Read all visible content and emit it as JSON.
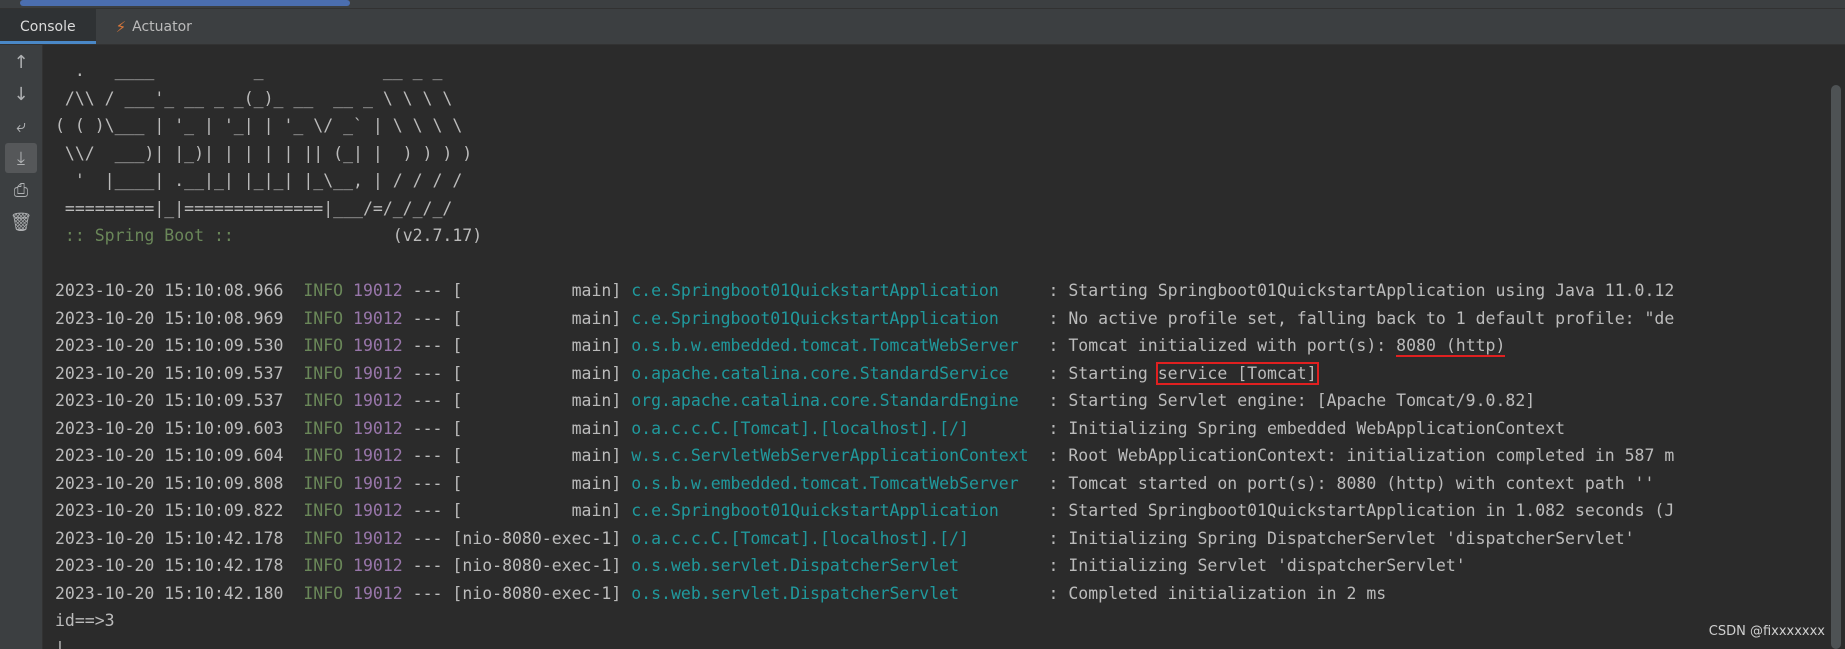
{
  "tabs": [
    {
      "label": "Console",
      "active": true
    },
    {
      "label": "Actuator",
      "icon": "actuator-icon"
    }
  ],
  "toolbar": [
    {
      "name": "scroll-up-icon",
      "glyph": "↑"
    },
    {
      "name": "scroll-down-icon",
      "glyph": "↓"
    },
    {
      "name": "soft-wrap-icon",
      "glyph": "⤶"
    },
    {
      "name": "scroll-to-end-icon",
      "glyph": "⤓",
      "active": true
    },
    {
      "name": "print-icon",
      "glyph": "⎙"
    },
    {
      "name": "clear-all-icon",
      "glyph": "🗑"
    }
  ],
  "banner": [
    "  .   ____          _            __ _ _",
    " /\\\\ / ___'_ __ _ _(_)_ __  __ _ \\ \\ \\ \\",
    "( ( )\\___ | '_ | '_| | '_ \\/ _` | \\ \\ \\ \\",
    " \\\\/  ___)| |_)| | | | | || (_| |  ) ) ) )",
    "  '  |____| .__|_| |_|_| |_\\__, | / / / /",
    " =========|_|==============|___/=/_/_/_/"
  ],
  "spring_label": " :: Spring Boot :: ",
  "spring_version": "               (v2.7.17)",
  "logs": [
    {
      "ts": "2023-10-20 15:10:08.966",
      "level": "INFO",
      "pid": "19012",
      "thread": "           main",
      "logger": "c.e.Springboot01QuickstartApplication    ",
      "msg": "Starting Springboot01QuickstartApplication using Java 11.0.12"
    },
    {
      "ts": "2023-10-20 15:10:08.969",
      "level": "INFO",
      "pid": "19012",
      "thread": "           main",
      "logger": "c.e.Springboot01QuickstartApplication    ",
      "msg": "No active profile set, falling back to 1 default profile: \"de"
    },
    {
      "ts": "2023-10-20 15:10:09.530",
      "level": "INFO",
      "pid": "19012",
      "thread": "           main",
      "logger": "o.s.b.w.embedded.tomcat.TomcatWebServer  ",
      "msg_pre": "Tomcat initialized with port(s): ",
      "msg_hl": "8080 (http)",
      "msg_post": "",
      "hl": "underline"
    },
    {
      "ts": "2023-10-20 15:10:09.537",
      "level": "INFO",
      "pid": "19012",
      "thread": "           main",
      "logger": "o.apache.catalina.core.StandardService   ",
      "msg_pre": "Starting ",
      "msg_hl": "service [Tomcat]",
      "msg_post": "",
      "hl": "box"
    },
    {
      "ts": "2023-10-20 15:10:09.537",
      "level": "INFO",
      "pid": "19012",
      "thread": "           main",
      "logger": "org.apache.catalina.core.StandardEngine  ",
      "msg": "Starting Servlet engine: [Apache Tomcat/9.0.82]"
    },
    {
      "ts": "2023-10-20 15:10:09.603",
      "level": "INFO",
      "pid": "19012",
      "thread": "           main",
      "logger": "o.a.c.c.C.[Tomcat].[localhost].[/]       ",
      "msg": "Initializing Spring embedded WebApplicationContext"
    },
    {
      "ts": "2023-10-20 15:10:09.604",
      "level": "INFO",
      "pid": "19012",
      "thread": "           main",
      "logger": "w.s.c.ServletWebServerApplicationContext ",
      "msg": "Root WebApplicationContext: initialization completed in 587 m"
    },
    {
      "ts": "2023-10-20 15:10:09.808",
      "level": "INFO",
      "pid": "19012",
      "thread": "           main",
      "logger": "o.s.b.w.embedded.tomcat.TomcatWebServer  ",
      "msg": "Tomcat started on port(s): 8080 (http) with context path ''"
    },
    {
      "ts": "2023-10-20 15:10:09.822",
      "level": "INFO",
      "pid": "19012",
      "thread": "           main",
      "logger": "c.e.Springboot01QuickstartApplication    ",
      "msg": "Started Springboot01QuickstartApplication in 1.082 seconds (J"
    },
    {
      "ts": "2023-10-20 15:10:42.178",
      "level": "INFO",
      "pid": "19012",
      "thread": "nio-8080-exec-1",
      "logger": "o.a.c.c.C.[Tomcat].[localhost].[/]       ",
      "msg": "Initializing Spring DispatcherServlet 'dispatcherServlet'"
    },
    {
      "ts": "2023-10-20 15:10:42.178",
      "level": "INFO",
      "pid": "19012",
      "thread": "nio-8080-exec-1",
      "logger": "o.s.web.servlet.DispatcherServlet        ",
      "msg": "Initializing Servlet 'dispatcherServlet'"
    },
    {
      "ts": "2023-10-20 15:10:42.180",
      "level": "INFO",
      "pid": "19012",
      "thread": "nio-8080-exec-1",
      "logger": "o.s.web.servlet.DispatcherServlet        ",
      "msg": "Completed initialization in 2 ms"
    }
  ],
  "output_line": "id==>3",
  "cursor": "|",
  "watermark": "CSDN @fixxxxxxx",
  "colors": {
    "background": "#2b2b2b",
    "info": "#6a8759",
    "pid": "#9876aa",
    "logger": "#20999d",
    "highlight": "#e02020"
  }
}
